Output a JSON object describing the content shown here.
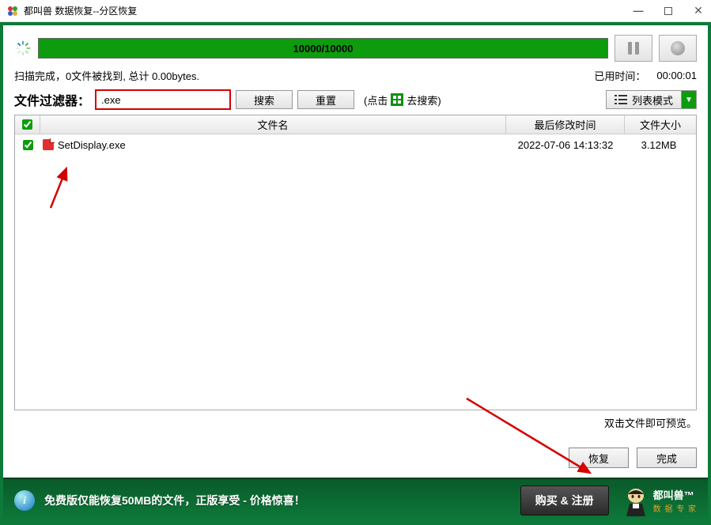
{
  "titlebar": {
    "title": "都叫兽 数据恢复--分区恢复"
  },
  "progress": {
    "text": "10000/10000"
  },
  "status": {
    "scan_text": "扫描完成，0文件被找到, 总计 0.00bytes.",
    "elapsed_label": "已用时间：",
    "elapsed_time": "00:00:01"
  },
  "filter": {
    "label": "文件过滤器：",
    "value": ".exe",
    "search_btn": "搜索",
    "reset_btn": "重置",
    "hint_prefix": "(点击",
    "hint_suffix": "去搜索)"
  },
  "view_mode": {
    "label": "列表模式"
  },
  "table": {
    "headers": {
      "name": "文件名",
      "date": "最后修改时间",
      "size": "文件大小"
    },
    "rows": [
      {
        "checked": true,
        "name": "SetDisplay.exe",
        "date": "2022-07-06 14:13:32",
        "size": "3.12MB"
      }
    ]
  },
  "preview_hint": "双击文件即可预览。",
  "buttons": {
    "recover": "恢复",
    "done": "完成"
  },
  "footer": {
    "text": "免费版仅能恢复50MB的文件，正版享受 - 价格惊喜！",
    "buy": "购买 & 注册",
    "brand_top": "都叫兽™",
    "brand_sub": "数 据 专 家"
  }
}
